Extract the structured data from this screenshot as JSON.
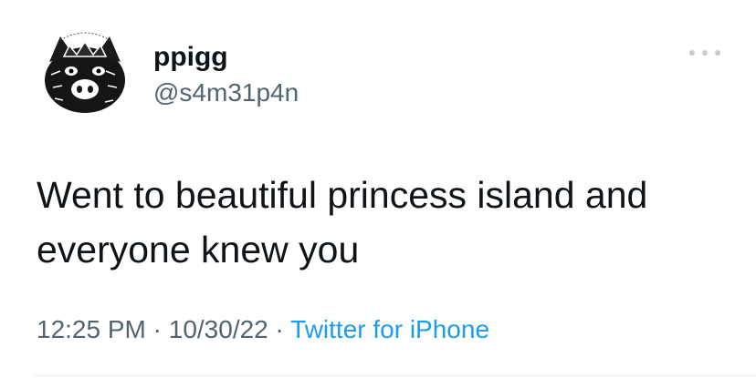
{
  "user": {
    "display_name": "ppigg",
    "handle": "@s4m31p4n"
  },
  "tweet": {
    "line1": "Went to beautiful princess island and",
    "line2": "everyone knew you"
  },
  "meta": {
    "time": "12:25 PM",
    "sep1": " · ",
    "date": "10/30/22",
    "sep2": " · ",
    "source": "Twitter for iPhone"
  },
  "colors": {
    "text": "#0f1419",
    "secondary": "#536471",
    "link": "#1d9bf0",
    "divider": "#eff3f4"
  },
  "icons": {
    "more": "more-options-icon"
  }
}
